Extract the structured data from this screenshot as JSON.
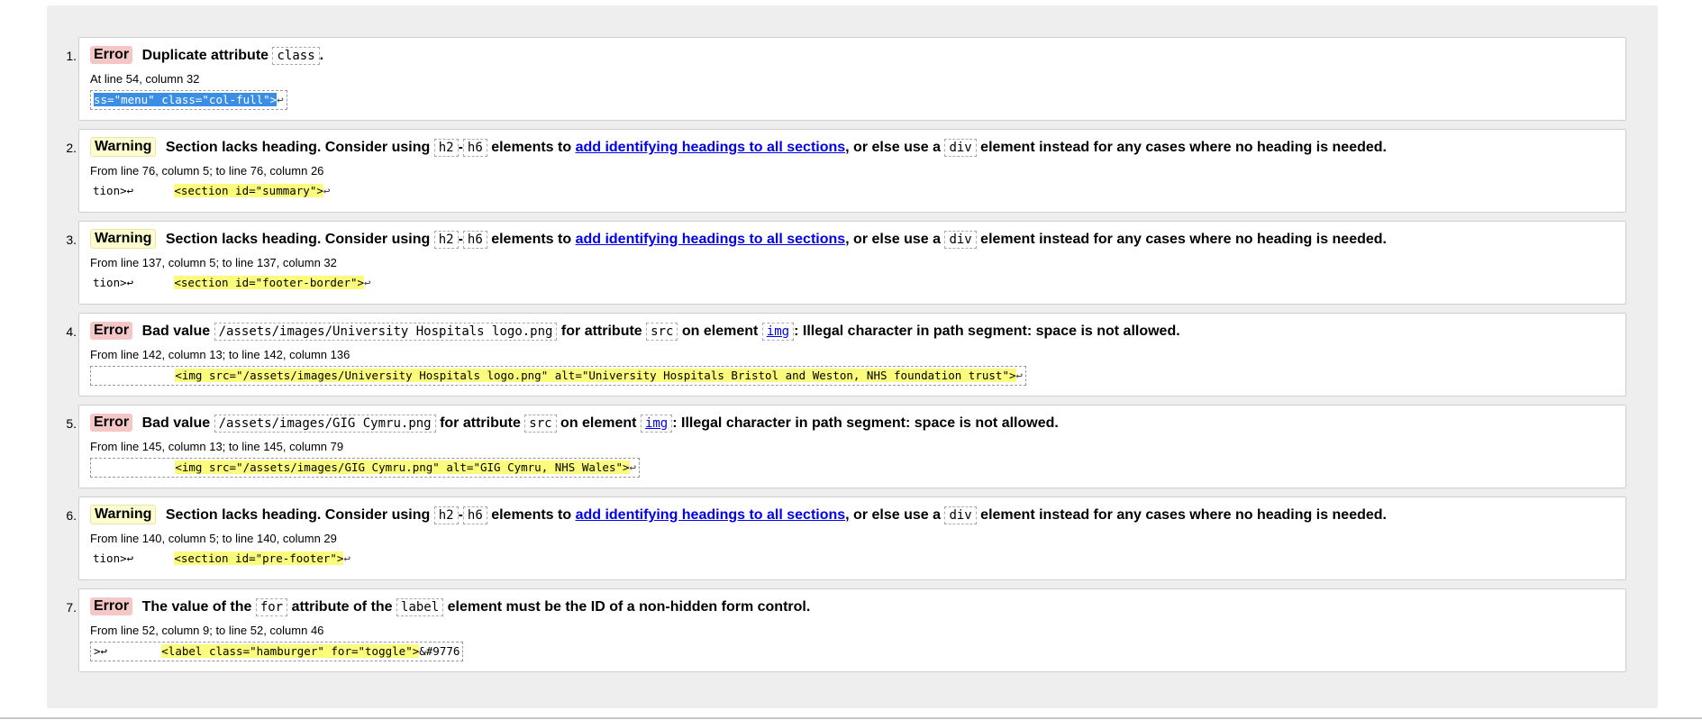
{
  "messages": [
    {
      "num": "1.",
      "type": "Error",
      "parts": {
        "t1": "Duplicate attribute ",
        "code1": "class",
        "t2": "."
      },
      "location": "At line 54, column 32",
      "extract": {
        "pre": "",
        "highlight": "ss=\"menu\" class=\"col-full\">",
        "post": "↩"
      }
    },
    {
      "num": "2.",
      "type": "Warning",
      "parts": {
        "t1": "Section lacks heading. Consider using ",
        "code1": "h2",
        "dash": "-",
        "code2": "h6",
        "t2": " elements to ",
        "link": "add identifying headings to all sections",
        "t3": ", or else use a ",
        "code3": "div",
        "t4": " element instead for any cases where no heading is needed."
      },
      "location": "From line 76, column 5; to line 76, column 26",
      "extract": {
        "pre": "tion>↩      ",
        "highlight": "<section id=\"summary\">",
        "post": "↩"
      }
    },
    {
      "num": "3.",
      "type": "Warning",
      "parts": {
        "t1": "Section lacks heading. Consider using ",
        "code1": "h2",
        "dash": "-",
        "code2": "h6",
        "t2": " elements to ",
        "link": "add identifying headings to all sections",
        "t3": ", or else use a ",
        "code3": "div",
        "t4": " element instead for any cases where no heading is needed."
      },
      "location": "From line 137, column 5; to line 137, column 32",
      "extract": {
        "pre": "tion>↩      ",
        "highlight": "<section id=\"footer-border\">",
        "post": "↩"
      }
    },
    {
      "num": "4.",
      "type": "Error",
      "parts": {
        "t1": "Bad value ",
        "code1": "/assets/images/University Hospitals logo.png",
        "t2": " for attribute ",
        "code2": "src",
        "t3": " on element ",
        "link": "img",
        "t4": ": Illegal character in path segment: space is not allowed."
      },
      "location": "From line 142, column 13; to line 142, column 136",
      "extract": {
        "pre": "            ",
        "highlight": "<img src=\"/assets/images/University Hospitals logo.png\" alt=\"University Hospitals Bristol and Weston, NHS foundation trust\">",
        "post": "↩"
      }
    },
    {
      "num": "5.",
      "type": "Error",
      "parts": {
        "t1": "Bad value ",
        "code1": "/assets/images/GIG Cymru.png",
        "t2": " for attribute ",
        "code2": "src",
        "t3": " on element ",
        "link": "img",
        "t4": ": Illegal character in path segment: space is not allowed."
      },
      "location": "From line 145, column 13; to line 145, column 79",
      "extract": {
        "pre": "            ",
        "highlight": "<img src=\"/assets/images/GIG Cymru.png\" alt=\"GIG Cymru, NHS Wales\">",
        "post": "↩"
      }
    },
    {
      "num": "6.",
      "type": "Warning",
      "parts": {
        "t1": "Section lacks heading. Consider using ",
        "code1": "h2",
        "dash": "-",
        "code2": "h6",
        "t2": " elements to ",
        "link": "add identifying headings to all sections",
        "t3": ", or else use a ",
        "code3": "div",
        "t4": " element instead for any cases where no heading is needed."
      },
      "location": "From line 140, column 5; to line 140, column 29",
      "extract": {
        "pre": "tion>↩      ",
        "highlight": "<section id=\"pre-footer\">",
        "post": "↩"
      }
    },
    {
      "num": "7.",
      "type": "Error",
      "parts": {
        "t1": "The value of the ",
        "code1": "for",
        "t2": " attribute of the ",
        "code2": "label",
        "t3": " element must be the ID of a non-hidden form control."
      },
      "location": "From line 52, column 9; to line 52, column 46",
      "extract": {
        "pre": ">↩        ",
        "highlight": "<label class=\"hamburger\" for=\"toggle\">",
        "post": "&#9776"
      }
    }
  ]
}
